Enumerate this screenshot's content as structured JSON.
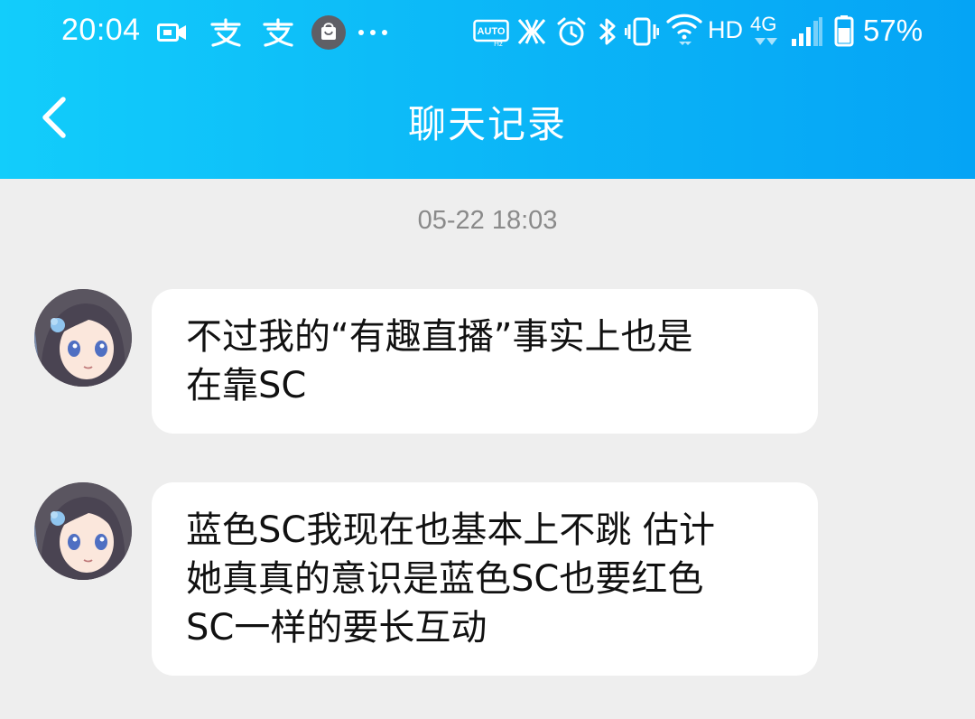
{
  "status_bar": {
    "time": "20:04",
    "network": "4G",
    "hd": "HD",
    "battery": "57%",
    "icons": [
      "video-camera-icon",
      "alipay-icon",
      "alipay-icon",
      "shopping-bag-icon",
      "more-dots-icon",
      "auto-hz-icon",
      "x-icon",
      "alarm-icon",
      "bluetooth-icon",
      "vibrate-icon",
      "wifi-icon",
      "signal-icon",
      "battery-icon"
    ]
  },
  "header": {
    "title": "聊天记录",
    "back_icon": "chevron-left-icon"
  },
  "chat": {
    "timestamp": "05-22 18:03",
    "messages": [
      {
        "lines": [
          "不过我的“有趣直播”事实上也是",
          "在靠SC"
        ]
      },
      {
        "lines": [
          "蓝色SC我现在也基本上不跳 估计",
          "她真真的意识是蓝色SC也要红色",
          "SC一样的要长互动"
        ]
      }
    ]
  },
  "colors": {
    "header_start": "#12cdfb",
    "header_end": "#05a4f5",
    "background": "#eeeeee",
    "bubble": "#ffffff",
    "timestamp": "#8a8a8a"
  }
}
